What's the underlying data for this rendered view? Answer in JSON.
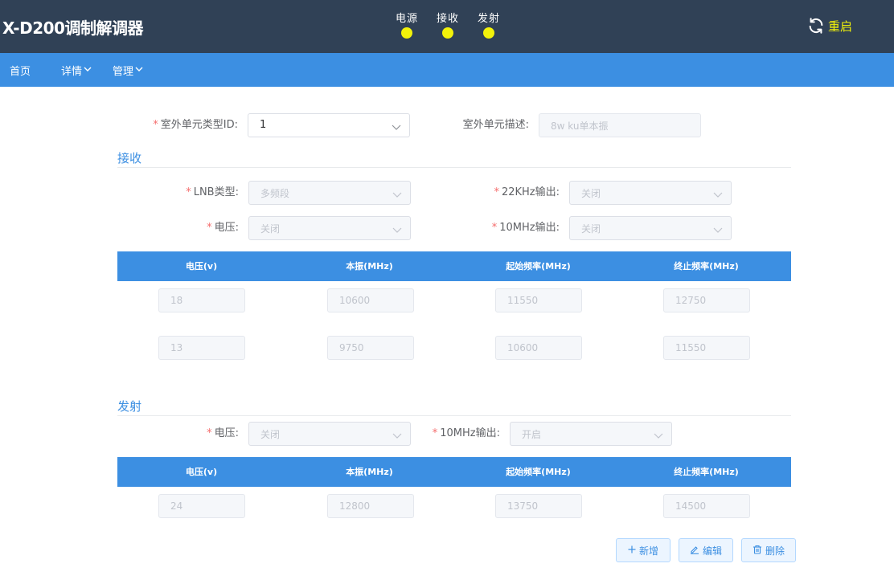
{
  "header": {
    "title": "X-D200调制解调器",
    "indicators": [
      {
        "label": "电源",
        "status_color": "#f2f20a"
      },
      {
        "label": "接收",
        "status_color": "#f2f20a"
      },
      {
        "label": "发射",
        "status_color": "#f2f20a"
      }
    ],
    "restart_label": "重启",
    "restart_icon": "refresh-icon"
  },
  "nav": {
    "home": "首页",
    "details": "详情",
    "manage": "管理"
  },
  "odu": {
    "type_id_label": "室外单元类型ID:",
    "type_id_value": "1",
    "desc_label": "室外单元描述:",
    "desc_value": "8w ku单本振"
  },
  "receive": {
    "title": "接收",
    "lnb_type_label": "LNB类型:",
    "lnb_type_value": "多频段",
    "khz22_label": "22KHz输出:",
    "khz22_value": "关闭",
    "voltage_label": "电压:",
    "voltage_value": "关闭",
    "mhz10_label": "10MHz输出:",
    "mhz10_value": "关闭",
    "table": {
      "headers": [
        "电压(v)",
        "本振(MHz)",
        "起始频率(MHz)",
        "终止频率(MHz)"
      ],
      "rows": [
        [
          "18",
          "10600",
          "11550",
          "12750"
        ],
        [
          "13",
          "9750",
          "10600",
          "11550"
        ]
      ]
    }
  },
  "transmit": {
    "title": "发射",
    "voltage_label": "电压:",
    "voltage_value": "关闭",
    "mhz10_label": "10MHz输出:",
    "mhz10_value": "开启",
    "table": {
      "headers": [
        "电压(v)",
        "本振(MHz)",
        "起始频率(MHz)",
        "终止频率(MHz)"
      ],
      "rows": [
        [
          "24",
          "12800",
          "13750",
          "14500"
        ]
      ]
    }
  },
  "actions": {
    "add": "新增",
    "edit": "编辑",
    "delete": "删除"
  },
  "colors": {
    "header_bg": "#304156",
    "nav_bg": "#3c8fe2",
    "status_on": "#f2f20a",
    "required": "#f56c6c"
  }
}
